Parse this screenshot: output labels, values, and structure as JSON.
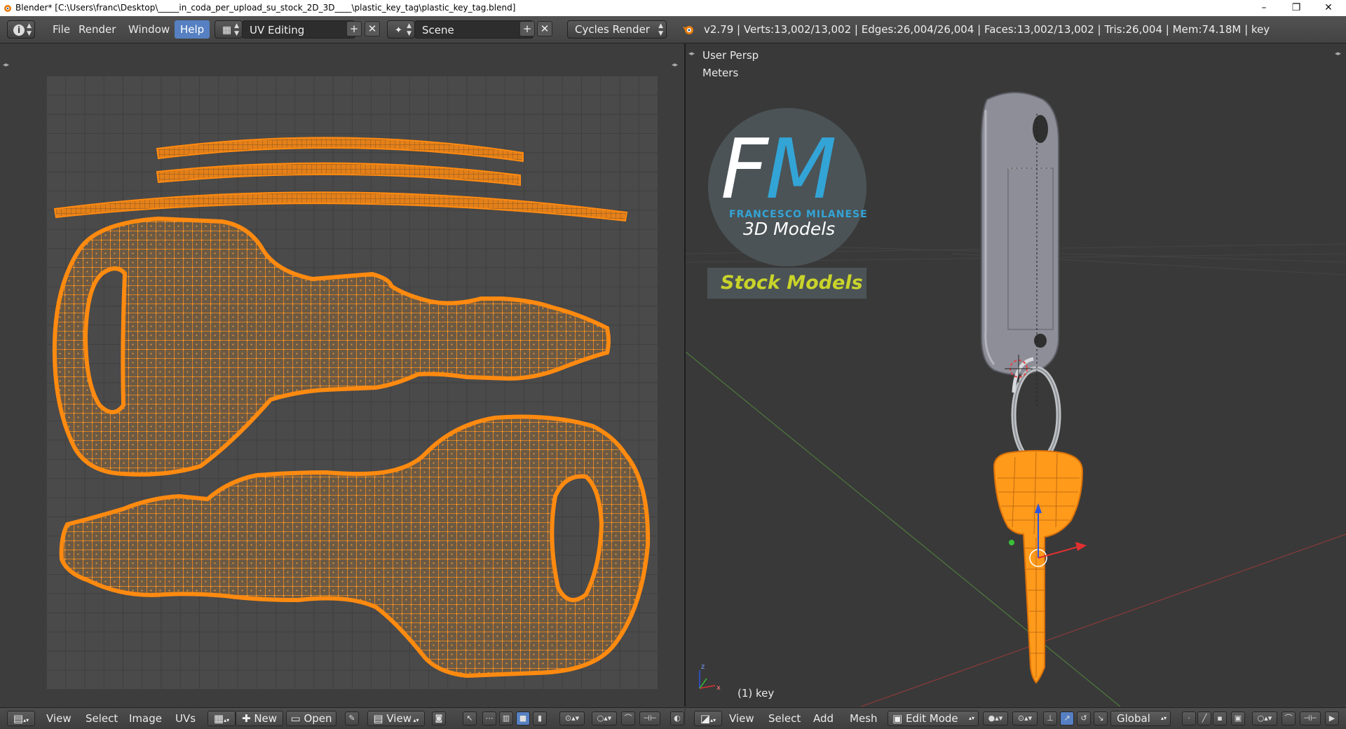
{
  "window": {
    "title": "Blender* [C:\\Users\\franc\\Desktop\\_____in_coda_per_upload_su_stock_2D_3D____\\plastic_key_tag\\plastic_key_tag.blend]",
    "minimize": "–",
    "restore": "❐",
    "close": "✕"
  },
  "header": {
    "info_icon": "i",
    "menus": [
      "File",
      "Render",
      "Window",
      "Help"
    ],
    "active_menu": "Help",
    "screen_layout": "UV Editing",
    "scene": "Scene",
    "render_engine": "Cycles Render",
    "stats": "v2.79 | Verts:13,002/13,002 | Edges:26,004/26,004 | Faces:13,002/13,002 | Tris:26,004 | Mem:74.18M | key",
    "add": "+",
    "remove": "✕"
  },
  "uv_editor": {
    "footer_menus": [
      "View",
      "Select",
      "Image",
      "UVs"
    ],
    "new_label": "New",
    "open_label": "Open",
    "view_label": "View"
  },
  "viewport": {
    "view_name": "User Persp",
    "units": "Meters",
    "object_label": "(1) key",
    "footer_menus": [
      "View",
      "Select",
      "Add",
      "Mesh"
    ],
    "mode": "Edit Mode",
    "orientation": "Global",
    "logo": {
      "letters": "FM",
      "name": "FRANCESCO MILANESE",
      "subtitle": "3D Models",
      "tagline": "Stock Models"
    }
  },
  "colors": {
    "uv_orange": "#ff8a10",
    "selection_blue": "#5680c2",
    "logo_blue": "#33a4d6",
    "tagline_yellow": "#c9d42a",
    "tag_gray": "#8e8e98"
  }
}
